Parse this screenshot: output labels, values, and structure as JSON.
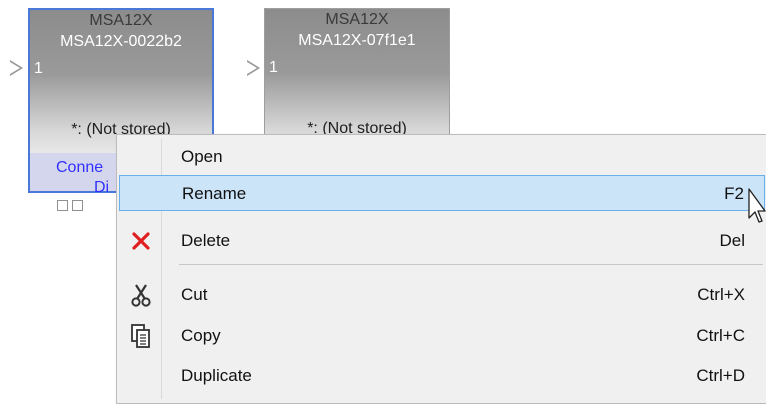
{
  "devices": [
    {
      "type": "MSA12X",
      "name": "MSA12X-0022b2",
      "port": "1",
      "status": "*: (Not stored)",
      "footer_line1": "Conne",
      "footer_line2": "Di"
    },
    {
      "type": "MSA12X",
      "name": "MSA12X-07f1e1",
      "port": "1",
      "status": "*: (Not stored)"
    }
  ],
  "context_menu": {
    "items": [
      {
        "label": "Open",
        "shortcut": "",
        "icon": ""
      },
      {
        "label": "Rename",
        "shortcut": "F2",
        "icon": "",
        "highlighted": true
      },
      {
        "label": "Delete",
        "shortcut": "Del",
        "icon": "delete-x-icon"
      },
      {
        "label": "Cut",
        "shortcut": "Ctrl+X",
        "icon": "scissors-icon"
      },
      {
        "label": "Copy",
        "shortcut": "Ctrl+C",
        "icon": "copy-icon"
      },
      {
        "label": "Duplicate",
        "shortcut": "Ctrl+D",
        "icon": ""
      }
    ]
  },
  "colors": {
    "selection_border": "#4a78d8",
    "highlight_bg": "#cce4f7",
    "delete_red": "#e02020",
    "link_blue": "#3030ff"
  }
}
